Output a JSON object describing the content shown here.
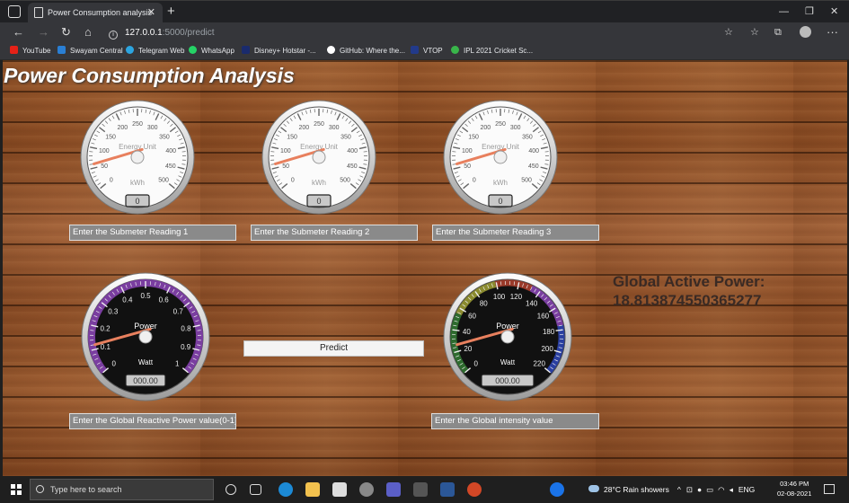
{
  "browser": {
    "tab_title": "Power Consumption analysis",
    "close_glyph": "✕",
    "new_tab_glyph": "+",
    "window_controls": [
      "—",
      "❐",
      "✕"
    ],
    "url_host": "127.0.0.1",
    "url_path": ":5000/predict",
    "bookmarks": [
      {
        "label": "YouTube",
        "color": "#e62117"
      },
      {
        "label": "Swayam Central",
        "color": "#2a7fd4"
      },
      {
        "label": "Telegram Web",
        "color": "#2ca5e0"
      },
      {
        "label": "WhatsApp",
        "color": "#25d366"
      },
      {
        "label": "Disney+ Hotstar -...",
        "color": "#1a2b6d"
      },
      {
        "label": "GitHub: Where the...",
        "color": "#ffffff"
      },
      {
        "label": "VTOP",
        "color": "#223a8a"
      },
      {
        "label": "IPL 2021 Cricket Sc...",
        "color": "#39b54a"
      }
    ]
  },
  "page": {
    "title": "Power Consumption Analysis",
    "energy_gauges": [
      {
        "label": "Energy Unit",
        "unit": "kWh",
        "value": "0",
        "field_label": "Enter the Submeter Reading 1"
      },
      {
        "label": "Energy Unit",
        "unit": "kWh",
        "value": "0",
        "field_label": "Enter the Submeter Reading 2"
      },
      {
        "label": "Energy Unit",
        "unit": "kWh",
        "value": "0",
        "field_label": "Enter the Submeter Reading 3"
      }
    ],
    "energy_ticks": [
      "0",
      "50",
      "100",
      "150",
      "200",
      "250",
      "300",
      "350",
      "400",
      "450",
      "500"
    ],
    "reactive_gauge": {
      "label": "Power",
      "unit": "Watt",
      "value": "000.00",
      "field_label": "Enter the Global Reactive Power value(0-1)",
      "ticks": [
        "0",
        "0.1",
        "0.2",
        "0.3",
        "0.4",
        "0.5",
        "0.6",
        "0.7",
        "0.8",
        "0.9",
        "1"
      ]
    },
    "intensity_gauge": {
      "label": "Power",
      "unit": "Watt",
      "value": "000.00",
      "field_label": "Enter the Global intensity value",
      "ticks": [
        "0",
        "20",
        "40",
        "60",
        "80",
        "100",
        "120",
        "140",
        "160",
        "180",
        "200",
        "220"
      ]
    },
    "predict_label": "Predict",
    "result_label": "Global Active Power:",
    "result_value": "18.813874550365277"
  },
  "taskbar": {
    "search_placeholder": "Type here to search",
    "weather": "28°C  Rain showers",
    "language": "ENG",
    "time": "03:46 PM",
    "date": "02-08-2021"
  }
}
